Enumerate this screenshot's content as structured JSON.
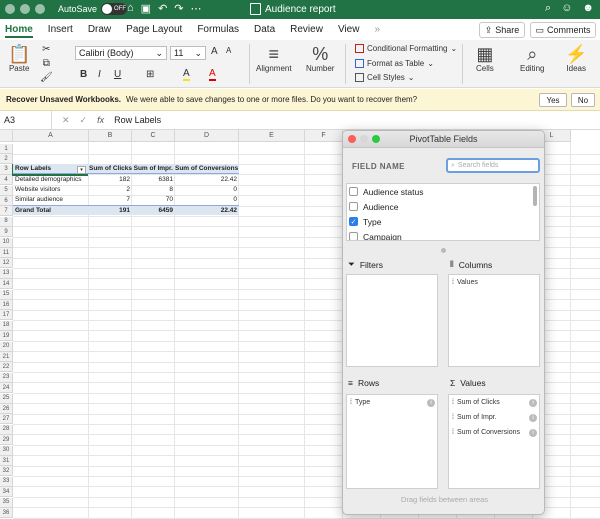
{
  "titlebar": {
    "autosave_label": "AutoSave",
    "autosave_state": "OFF",
    "document_title": "Audience report",
    "icons": [
      "save-icon",
      "undo-icon",
      "redo-icon",
      "more-icon",
      "search-icon",
      "smiley-icon"
    ]
  },
  "menu": {
    "tabs": [
      "Home",
      "Insert",
      "Draw",
      "Page Layout",
      "Formulas",
      "Data",
      "Review",
      "View"
    ],
    "active_tab": "Home",
    "more": "»",
    "share_label": "Share",
    "comments_label": "Comments"
  },
  "ribbon": {
    "paste_label": "Paste",
    "font_name": "Calibri (Body)",
    "font_size": "11",
    "bold": "B",
    "italic": "I",
    "underline": "U",
    "grow_font": "A",
    "shrink_font": "A",
    "highlight": "A",
    "font_color": "A",
    "alignment_label": "Alignment",
    "number_label": "Number",
    "conditional_formatting": "Conditional Formatting",
    "format_as_table": "Format as Table",
    "cell_styles": "Cell Styles",
    "cells_label": "Cells",
    "editing_label": "Editing",
    "ideas_label": "Ideas",
    "accent": "#217346"
  },
  "notification": {
    "title": "Recover Unsaved Workbooks.",
    "message": "We were able to save changes to one or more files. Do you want to recover them?",
    "yes_label": "Yes",
    "no_label": "No"
  },
  "formula_bar": {
    "cell_ref": "A3",
    "cancel": "✕",
    "enter": "✓",
    "fx": "fx",
    "content": "Row Labels"
  },
  "sheet": {
    "columns": [
      "A",
      "B",
      "C",
      "D",
      "E",
      "F",
      "G",
      "H",
      "I",
      "J",
      "K",
      "L"
    ],
    "rows": [
      "1",
      "2",
      "3",
      "4",
      "5",
      "6",
      "7",
      "8",
      "9",
      "10",
      "11",
      "12",
      "13",
      "14",
      "15",
      "16",
      "17",
      "18",
      "19",
      "20",
      "21",
      "22",
      "23",
      "24",
      "25",
      "26",
      "27",
      "28",
      "29",
      "30",
      "31",
      "32",
      "33",
      "34",
      "35",
      "36"
    ],
    "pivot_headers": [
      "Row Labels",
      "Sum of Clicks",
      "Sum of Impr.",
      "Sum of Conversions"
    ],
    "pivot_rows": [
      [
        "Detailed demographics",
        "182",
        "6381",
        "22.42"
      ],
      [
        "Website visitors",
        "2",
        "8",
        "0"
      ],
      [
        "Similar audience",
        "7",
        "70",
        "0"
      ]
    ],
    "grand_total": [
      "Grand Total",
      "191",
      "6459",
      "22.42"
    ]
  },
  "pivot_panel": {
    "title": "PivotTable Fields",
    "field_name_label": "FIELD NAME",
    "search_placeholder": "Search fields",
    "fields": [
      {
        "label": "Audience status",
        "checked": false
      },
      {
        "label": "Audience",
        "checked": false
      },
      {
        "label": "Type",
        "checked": true
      },
      {
        "label": "Campaign",
        "checked": false
      }
    ],
    "filters_label": "Filters",
    "columns_label": "Columns",
    "rows_label": "Rows",
    "values_label": "Values",
    "columns_items": [
      "Values"
    ],
    "rows_items": [
      "Type"
    ],
    "values_items": [
      "Sum of Clicks",
      "Sum of Impr.",
      "Sum of Conversions"
    ],
    "hint": "Drag fields between areas"
  }
}
